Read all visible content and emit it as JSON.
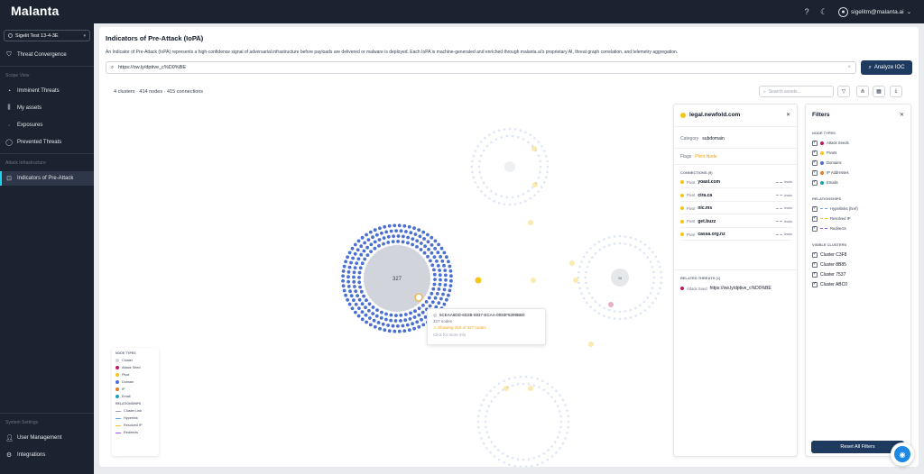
{
  "app": {
    "logo": "Malanta",
    "help_icon": "help-circle-icon",
    "theme_icon": "moon-icon",
    "user_email": "sigelitm@malanta.ai"
  },
  "sidebar": {
    "workspace": "Sigelit Test 13-4-3E",
    "top_items": [
      {
        "label": "Threat Convergence",
        "icon": "shield-icon"
      }
    ],
    "scope_view_heading": "Scope View",
    "scope_items": [
      {
        "label": "Imminent Threats",
        "icon": "chart-icon"
      },
      {
        "label": "My assets",
        "icon": "bars-icon"
      },
      {
        "label": "Exposures",
        "icon": "dot-icon"
      },
      {
        "label": "Prevented Threats",
        "icon": "shield-icon"
      }
    ],
    "attack_heading": "Attack Infrastructure",
    "attack_items": [
      {
        "label": "Indicators of Pre-Attack",
        "icon": "target-icon",
        "active": true
      }
    ],
    "settings_heading": "System Settings",
    "settings_items": [
      {
        "label": "User Management",
        "icon": "user-icon"
      },
      {
        "label": "Integrations",
        "icon": "plug-icon"
      }
    ]
  },
  "page": {
    "title": "Indicators of Pre-Attack (IoPA)",
    "description": "An Indicator of Pre-Attack (IoPA) represents a high-confidence signal of adversarial infrastructure before payloads are delivered or malware is deployed. Each IoPA is machine-generated and enriched through malanta.ai's proprietary AI, threat graph correlation, and telemetry aggregation.",
    "search_value": "https://ow.ly/dptive_c%D0%BE",
    "analyze_label": "Analyze IOC",
    "stats": "4 clusters · 414 nodes · 415 connections",
    "graph_search_placeholder": "Search assets..."
  },
  "graph": {
    "main_cluster_count": "327",
    "other_cluster_count": "38",
    "colors": {
      "domain": "#4a6fd0",
      "pivot": "#f5c518",
      "cluster": "#d1d5db",
      "attack": "#c2185b",
      "ip": "#e67e22",
      "email": "#17a2b8"
    }
  },
  "tooltip": {
    "id": "5CEAA6DD-6D2B-5937-ECAA-0093F8399BB0",
    "nodes": "327 nodes",
    "showing": "Showing 250 of 327 nodes",
    "hint": "Click for more info"
  },
  "legend": {
    "node_types_title": "NODE TYPES",
    "node_types": [
      {
        "label": "Cluster",
        "color": "#d1d5db"
      },
      {
        "label": "Attack Seed",
        "color": "#c2185b"
      },
      {
        "label": "Pivot",
        "color": "#f5c518"
      },
      {
        "label": "Domain",
        "color": "#4a6fd0"
      },
      {
        "label": "IP",
        "color": "#e67e22"
      },
      {
        "label": "Email",
        "color": "#17a2b8"
      }
    ],
    "relationships_title": "RELATIONSHIPS",
    "relationships": [
      {
        "label": "Cluster Link",
        "color": "#9ca3af"
      },
      {
        "label": "Hyperlink",
        "color": "#60a5fa"
      },
      {
        "label": "Resolved IP",
        "color": "#fbbf24"
      },
      {
        "label": "Redirects",
        "color": "#a855f7"
      }
    ]
  },
  "details": {
    "name": "legal.newfold.com",
    "category_label": "Category",
    "category_value": "subdomain",
    "flags_label": "Flags",
    "flags_value": "Pivot Node",
    "connections_title": "CONNECTIONS (5)",
    "connections": [
      {
        "type": "Pivot",
        "name": "yoast.com",
        "rel": "leads"
      },
      {
        "type": "Pivot",
        "name": "cira.ca",
        "rel": "leads"
      },
      {
        "type": "Pivot",
        "name": "nic.ms",
        "rel": "leads"
      },
      {
        "type": "Pivot",
        "name": "get.buzz",
        "rel": "leads"
      },
      {
        "type": "Pivot",
        "name": "cassa.org.nz",
        "rel": "leads"
      }
    ],
    "threats_title": "RELATED THREATS (1)",
    "threat_type": "Attack Seed",
    "threat_name": "https://ow.ly/dptive_c%D0%BE"
  },
  "filters": {
    "title": "Filters",
    "node_types_title": "NODE TYPES",
    "node_types": [
      {
        "label": "Attack Seeds",
        "color": "#c2185b"
      },
      {
        "label": "Pivots",
        "color": "#f5c518"
      },
      {
        "label": "Domains",
        "color": "#4a6fd0"
      },
      {
        "label": "IP Addresses",
        "color": "#e67e22"
      },
      {
        "label": "Emails",
        "color": "#17a2b8"
      }
    ],
    "relationships_title": "RELATIONSHIPS",
    "relationships": [
      {
        "label": "Hyperlinks (href)",
        "color": "#60a5fa"
      },
      {
        "label": "Resolved IP",
        "color": "#fbbf24"
      },
      {
        "label": "Redirects",
        "color": "#a855f7"
      }
    ],
    "clusters_title": "VISIBLE CLUSTERS",
    "clusters": [
      "Cluster C3F8",
      "Cluster 8B85",
      "Cluster 7537",
      "Cluster ABC0"
    ],
    "reset_label": "Reset All Filters"
  }
}
